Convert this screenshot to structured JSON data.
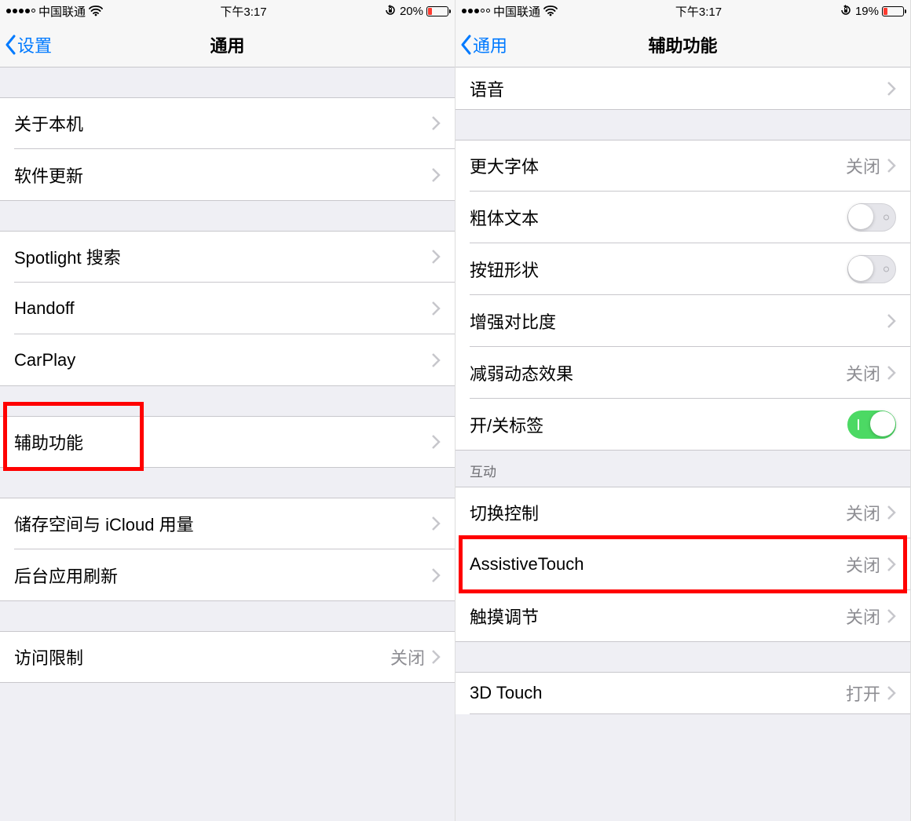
{
  "left": {
    "status": {
      "carrier": "中国联通",
      "time": "下午3:17",
      "battery_pct": "20%",
      "battery_width": "20%"
    },
    "nav": {
      "back_label": "设置",
      "title": "通用"
    },
    "rows": {
      "about": "关于本机",
      "software_update": "软件更新",
      "spotlight": "Spotlight 搜索",
      "handoff": "Handoff",
      "carplay": "CarPlay",
      "accessibility": "辅助功能",
      "storage_icloud": "储存空间与 iCloud 用量",
      "background_refresh": "后台应用刷新",
      "restrictions": "访问限制",
      "restrictions_value": "关闭"
    }
  },
  "right": {
    "status": {
      "carrier": "中国联通",
      "time": "下午3:17",
      "battery_pct": "19%",
      "battery_width": "19%"
    },
    "nav": {
      "back_label": "通用",
      "title": "辅助功能"
    },
    "section_header": "互动",
    "rows": {
      "voice": "语音",
      "larger_text": "更大字体",
      "larger_text_value": "关闭",
      "bold_text": "粗体文本",
      "button_shapes": "按钮形状",
      "increase_contrast": "增强对比度",
      "reduce_motion": "减弱动态效果",
      "reduce_motion_value": "关闭",
      "on_off_labels": "开/关标签",
      "switch_control": "切换控制",
      "switch_control_value": "关闭",
      "assistive_touch": "AssistiveTouch",
      "assistive_touch_value": "关闭",
      "touch_accommodations": "触摸调节",
      "touch_accommodations_value": "关闭",
      "three_d_touch": "3D Touch",
      "three_d_touch_value": "打开"
    }
  }
}
